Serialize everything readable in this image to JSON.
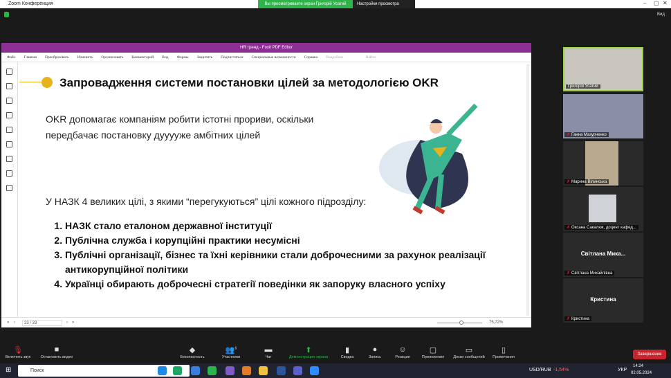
{
  "zoom": {
    "title": "Zoom Конференция",
    "share_banner": "Вы просматриваете экран Григорій Усатий",
    "view_options": "Настройки просмотра",
    "view_label": "Вид"
  },
  "pdf": {
    "title": "HR тренд - Foxit PDF Editor",
    "menu": [
      "Файл",
      "Главная",
      "Преобразовать",
      "Изменить",
      "Организовать",
      "Комментарий",
      "Вид",
      "Формы",
      "Защитить",
      "Подпистаться",
      "Специальные возможности",
      "Справка",
      "Подробнее",
      "Найти"
    ],
    "page": "23 / 33",
    "zoom": "75,72%"
  },
  "slide": {
    "heading": "Запровадження системи постановки цілей за методологією OKR",
    "intro_1": "OKR допомагає компаніям робити істотні прориви, оскільки",
    "intro_2": "передбачає постановку дууууже амбітних цілей",
    "lead": "У НАЗК 4 великих цілі, з якими “перегукуються” цілі кожного підрозділу:",
    "goals": [
      "НАЗК стало еталоном державної інституції",
      "Публічна служба і корупційні практики несумісні",
      "Публічні організації, бізнес та їхні керівники стали доброчесними за  рахунок реалізації антикорупційної політики",
      "Українці обирають доброчесні стратегії поведінки як запоруку власного успіху"
    ]
  },
  "participants": [
    {
      "name": "Григорій Усатий"
    },
    {
      "name": "Ганна Мазурченко"
    },
    {
      "name": "Марина Вілинська"
    },
    {
      "name": "Оксана Сакалюк, доцент кафед..."
    },
    {
      "name": "Світлана Михайлівна",
      "display": "Світлана  Мика..."
    },
    {
      "name": "Кристина",
      "display": "Кристина"
    }
  ],
  "toolbar": {
    "mute": "Включить звук",
    "video": "Остановить видео",
    "security": "Безопасность",
    "participants": "Участники",
    "participants_count": "6",
    "chat": "Чат",
    "share": "Демонстрация экрана",
    "summary": "Сводка",
    "record": "Запись",
    "reactions": "Реакции",
    "apps": "Приложения",
    "whiteboards": "Доски сообщений",
    "notes": "Примечания",
    "end": "Завершение"
  },
  "taskbar": {
    "search": "Поиск",
    "ticker": "USD/RUB",
    "change": "-1,54%",
    "lang": "УКР",
    "time": "14:24",
    "date": "02.05.2024"
  },
  "colors": {
    "accent": "#8e2f95",
    "bullet": "#e8b21a",
    "share": "#2fb34a",
    "end": "#c8262f"
  }
}
